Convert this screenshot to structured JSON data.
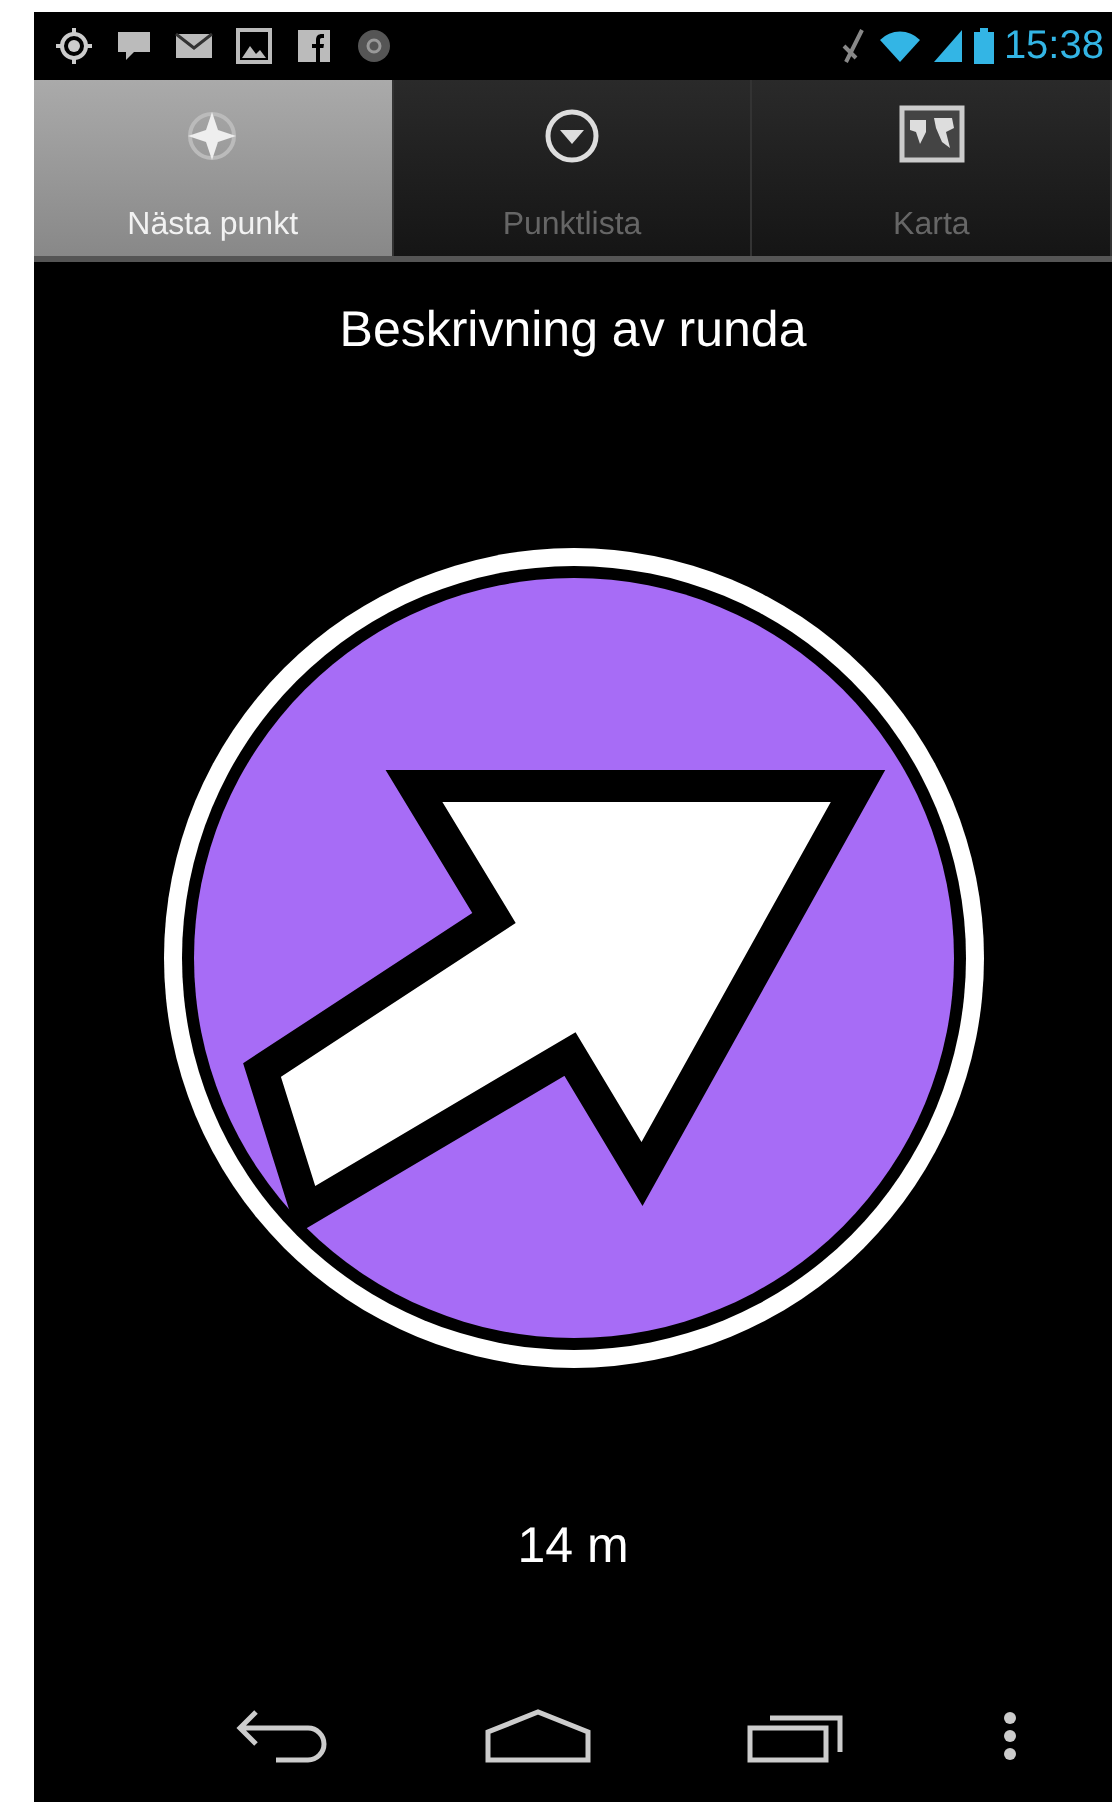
{
  "status_bar": {
    "time": "15:38"
  },
  "tabs": [
    {
      "label": "Nästa punkt",
      "kind": "compass",
      "selected": true
    },
    {
      "label": "Punktlista",
      "kind": "list",
      "selected": false
    },
    {
      "label": "Karta",
      "kind": "map",
      "selected": false
    }
  ],
  "title": "Beskrivning av runda",
  "distance": "14 m"
}
